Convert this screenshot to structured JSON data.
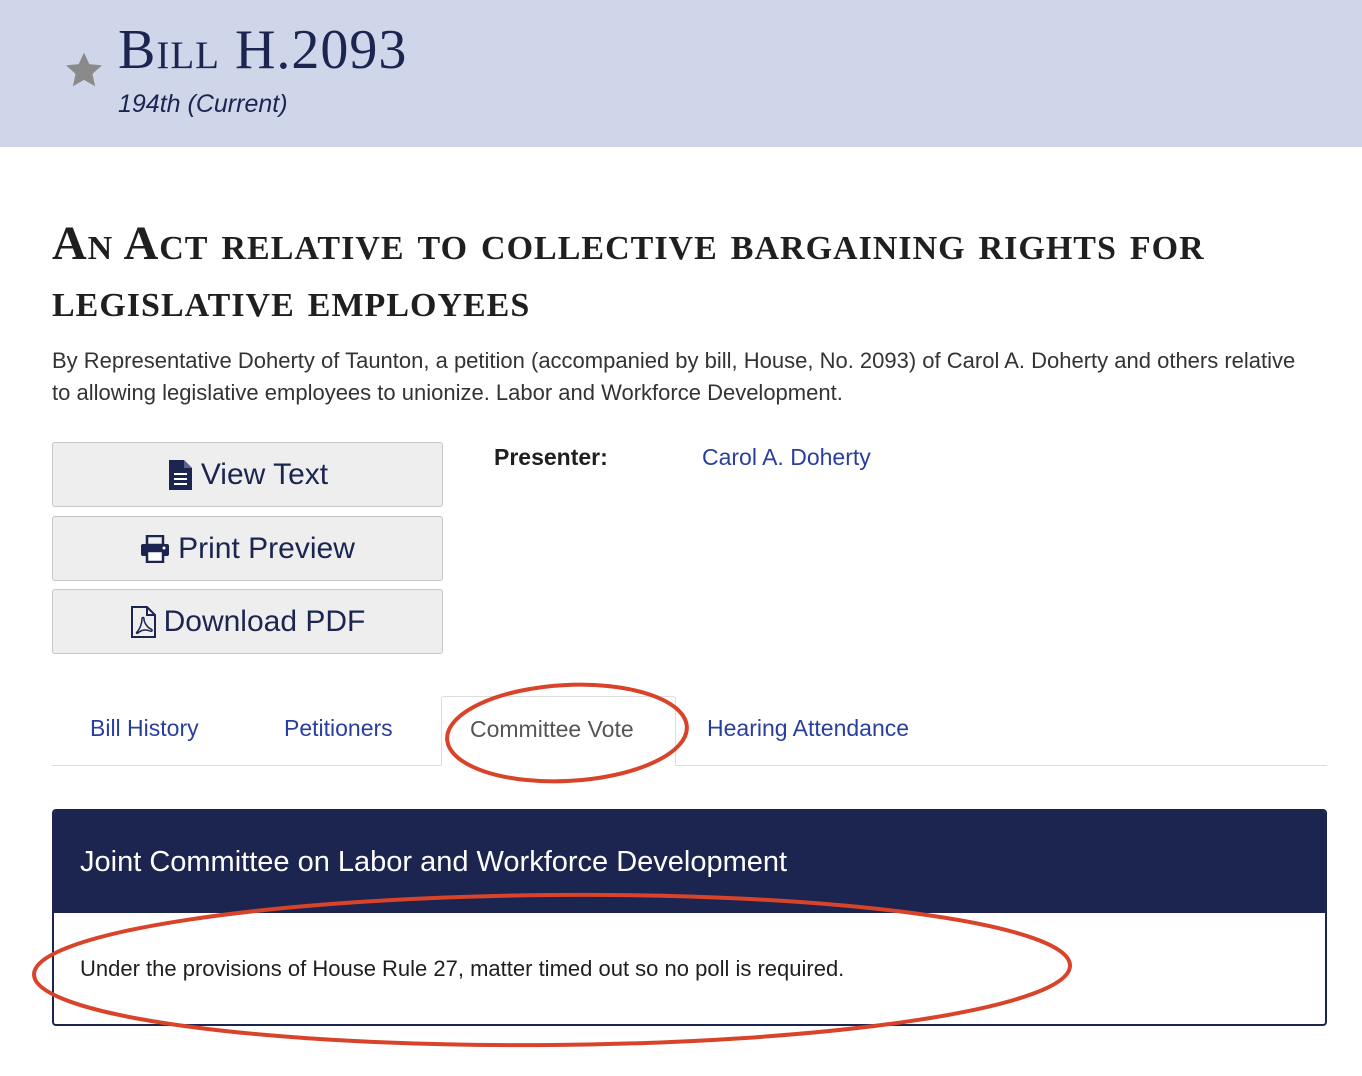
{
  "header": {
    "bill_title": "Bill H.2093",
    "session": "194th (Current)"
  },
  "act": {
    "title": "An Act relative to collective bargaining rights for legislative employees",
    "summary": "By Representative Doherty of Taunton, a petition (accompanied by bill, House, No. 2093) of Carol A. Doherty and others relative to allowing legislative employees to unionize. Labor and Workforce Development."
  },
  "actions": {
    "view_text": "View Text",
    "print_preview": "Print Preview",
    "download_pdf": "Download PDF"
  },
  "presenter": {
    "label": "Presenter:",
    "name": "Carol A. Doherty"
  },
  "tabs": [
    {
      "label": "Bill History"
    },
    {
      "label": "Petitioners"
    },
    {
      "label": "Committee Vote"
    },
    {
      "label": "Hearing Attendance"
    }
  ],
  "committee_panel": {
    "heading": "Joint Committee on Labor and Workforce Development",
    "body": "Under the provisions of House Rule 27, matter timed out so no poll is required."
  },
  "colors": {
    "header_bg": "#d0d6ea",
    "navy": "#1b2550",
    "link": "#2a3ea0",
    "annotation": "#d9432a"
  },
  "icons": [
    "star-icon",
    "document-icon",
    "printer-icon",
    "pdf-icon"
  ]
}
